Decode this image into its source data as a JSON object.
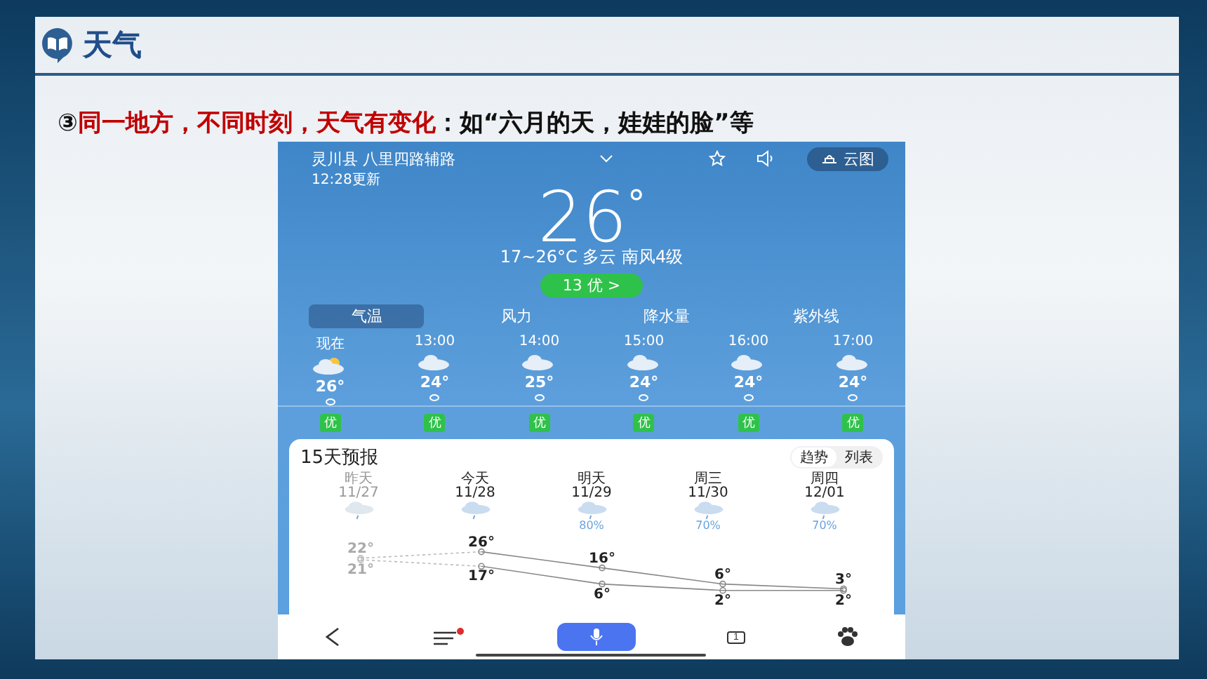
{
  "header": {
    "title": "天气"
  },
  "statement": {
    "marker": "③",
    "parts": [
      {
        "text": "同一地方，不同时刻，天气有变化",
        "emphasis": true
      },
      {
        "text": "：如“六月的天，娃娃的脸”等",
        "emphasis": false
      }
    ]
  },
  "phone": {
    "location": "灵川县 八里四路辅路",
    "cloud_map": "云图",
    "updated": "12:28更新",
    "temperature": "26",
    "degree": "°",
    "summary": "17~26°C 多云 南风4级",
    "aqi": "13 优 >",
    "tabs": [
      {
        "label": "气温",
        "selected": true
      },
      {
        "label": "风力",
        "selected": false
      },
      {
        "label": "降水量",
        "selected": false
      },
      {
        "label": "紫外线",
        "selected": false
      }
    ],
    "hours": [
      {
        "time": "现在",
        "kind": "partly-cloudy",
        "temp": "26°",
        "aqi": "优"
      },
      {
        "time": "13:00",
        "kind": "cloudy",
        "temp": "24°",
        "aqi": "优"
      },
      {
        "time": "14:00",
        "kind": "cloudy",
        "temp": "25°",
        "aqi": "优"
      },
      {
        "time": "15:00",
        "kind": "cloudy",
        "temp": "24°",
        "aqi": "优"
      },
      {
        "time": "16:00",
        "kind": "cloudy",
        "temp": "24°",
        "aqi": "优"
      },
      {
        "time": "17:00",
        "kind": "cloudy",
        "temp": "24°",
        "aqi": "优"
      }
    ],
    "forecast": {
      "title": "15天预报",
      "views": [
        {
          "label": "趋势",
          "selected": true
        },
        {
          "label": "列表",
          "selected": false
        }
      ],
      "days": [
        {
          "day": "昨天",
          "date": "11/27",
          "past": true,
          "high": "22°",
          "low": "21°"
        },
        {
          "day": "今天",
          "date": "11/28",
          "past": false,
          "high": "26°",
          "low": "17°"
        },
        {
          "day": "明天",
          "date": "11/29",
          "past": false,
          "rain": "80%",
          "high": "16°",
          "low": "6°"
        },
        {
          "day": "周三",
          "date": "11/30",
          "past": false,
          "rain": "70%",
          "high": "6°",
          "low": "2°"
        },
        {
          "day": "周四",
          "date": "12/01",
          "past": false,
          "rain": "70%",
          "high": "3°",
          "low": "2°"
        }
      ]
    },
    "nav": {
      "tab_count": "1",
      "unread": true
    }
  }
}
